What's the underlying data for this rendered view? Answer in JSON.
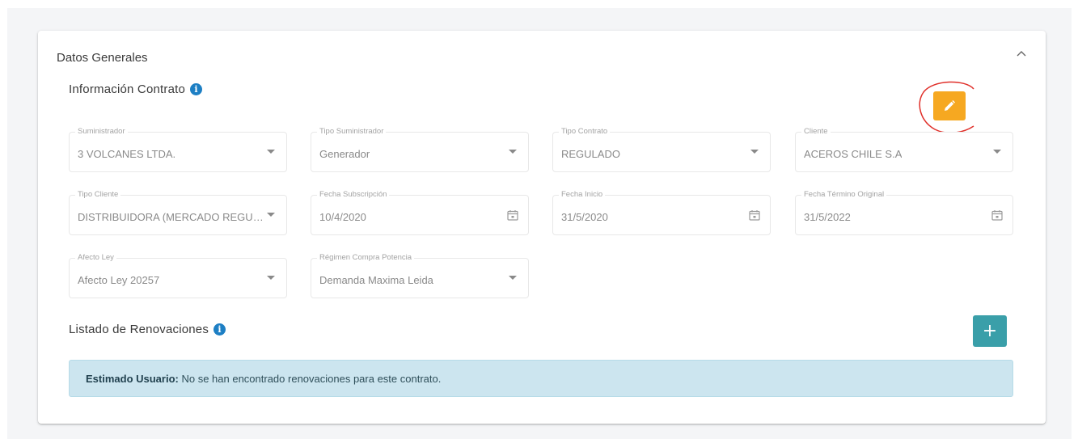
{
  "card": {
    "title": "Datos Generales"
  },
  "contract": {
    "title": "Información Contrato",
    "fields": [
      {
        "label": "Suministrador",
        "value": "3 VOLCANES LTDA.",
        "icon": "chevron-down-icon"
      },
      {
        "label": "Tipo Suministrador",
        "value": "Generador",
        "icon": "chevron-down-icon"
      },
      {
        "label": "Tipo Contrato",
        "value": "REGULADO",
        "icon": "chevron-down-icon"
      },
      {
        "label": "Cliente",
        "value": "ACEROS CHILE S.A",
        "icon": "chevron-down-icon"
      },
      {
        "label": "Tipo Cliente",
        "value": "DISTRIBUIDORA (MERCADO REGULADO)",
        "icon": "chevron-down-icon"
      },
      {
        "label": "Fecha Subscripción",
        "value": "10/4/2020",
        "icon": "calendar-icon"
      },
      {
        "label": "Fecha Inicio",
        "value": "31/5/2020",
        "icon": "calendar-icon"
      },
      {
        "label": "Fecha Término Original",
        "value": "31/5/2022",
        "icon": "calendar-icon"
      },
      {
        "label": "Afecto Ley",
        "value": "Afecto Ley 20257",
        "icon": "chevron-down-icon"
      },
      {
        "label": "Régimen Compra Potencia",
        "value": "Demanda Maxima Leida",
        "icon": "chevron-down-icon"
      }
    ]
  },
  "renewals": {
    "title": "Listado de Renovaciones",
    "add_label": "+",
    "alert_strong": "Estimado Usuario:",
    "alert_text": " No se han encontrado renovaciones para este contrato."
  },
  "colors": {
    "edit_button": "#f6a821",
    "add_button": "#3a9fa9",
    "info_icon": "#1d7fc4",
    "alert_bg": "#cce5ef",
    "annotation": "#e0302a"
  }
}
